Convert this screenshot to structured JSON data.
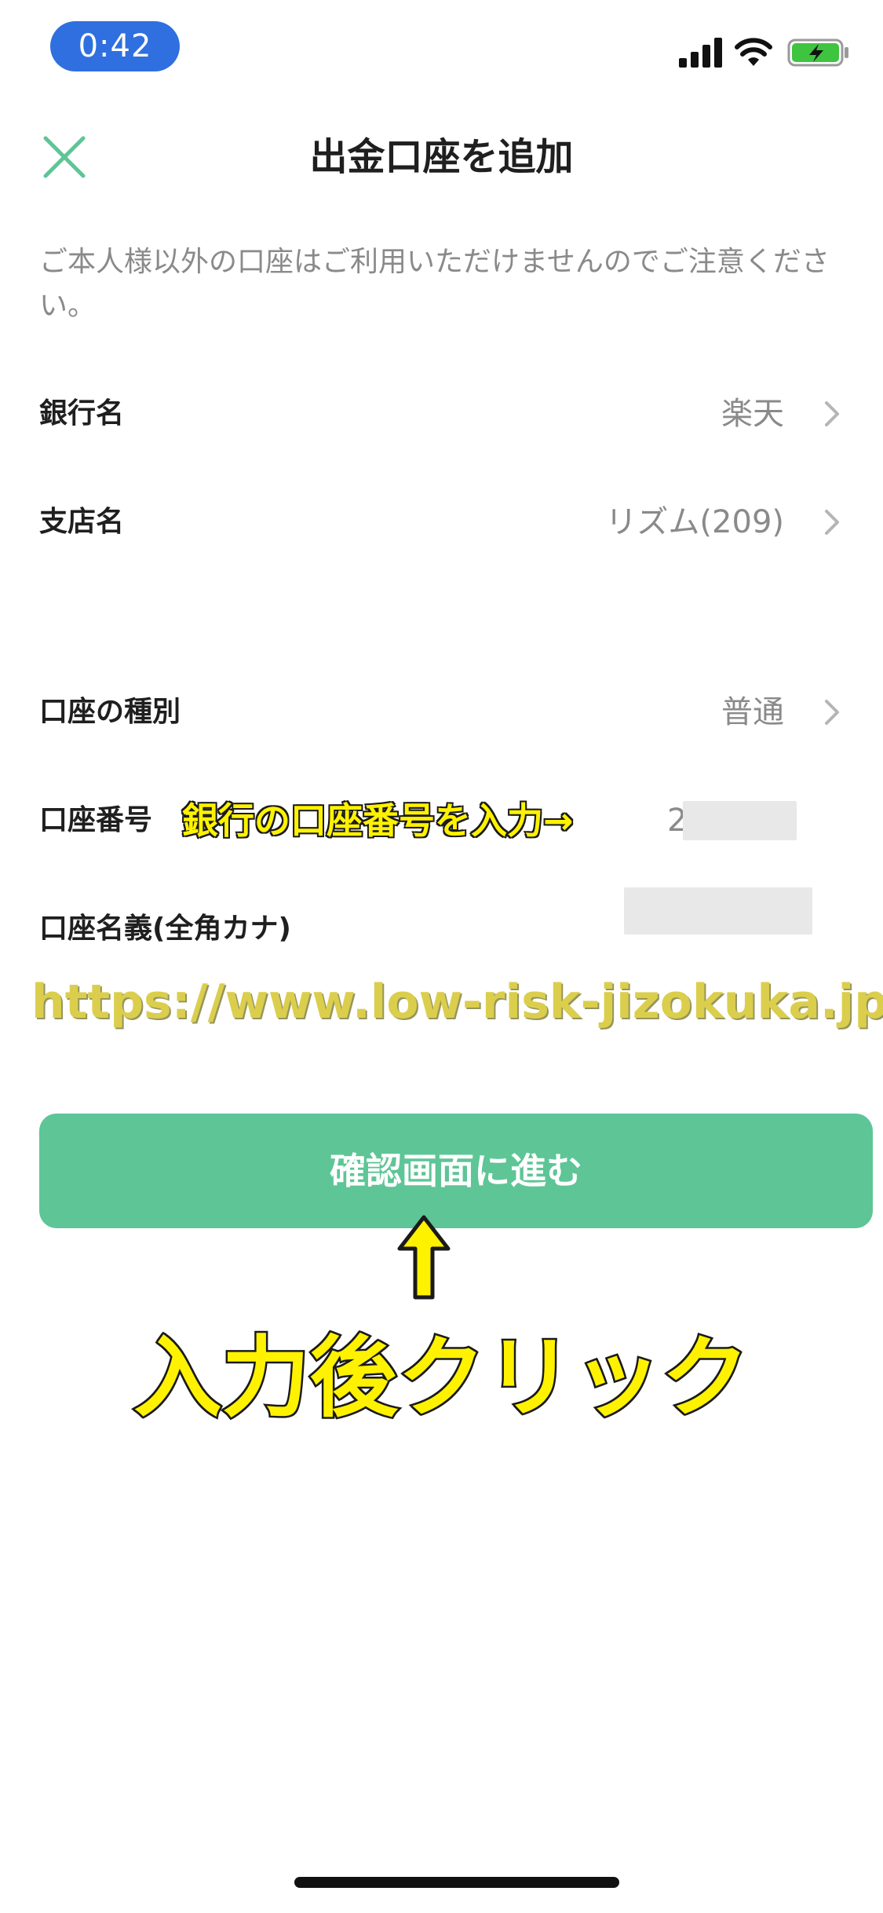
{
  "status_bar": {
    "time": "0:42",
    "icons": [
      "signal-icon",
      "wifi-icon",
      "battery-charging-icon"
    ]
  },
  "header": {
    "title": "出金口座を追加",
    "close_icon": "close-icon"
  },
  "notice": "ご本人様以外の口座はご利用いただけませんのでご注意ください。",
  "rows": [
    {
      "label": "銀行名",
      "value": "楽天"
    },
    {
      "label": "支店名",
      "value": "リズム(209)"
    },
    {
      "label": "口座の種別",
      "value": "普通"
    },
    {
      "label": "口座番号",
      "value": "2"
    },
    {
      "label": "口座名義(全角カナ)",
      "value": ""
    }
  ],
  "annotations": {
    "inline": "銀行の口座番号を入力→",
    "watermark": "https://www.low-risk-jizokuka.jp/",
    "after_input": "入力後クリック"
  },
  "primary_button": {
    "label": "確認画面に進む"
  },
  "colors": {
    "accent": "#5ec596",
    "time_pill": "#2f6fe0",
    "annotation": "#fff200"
  }
}
